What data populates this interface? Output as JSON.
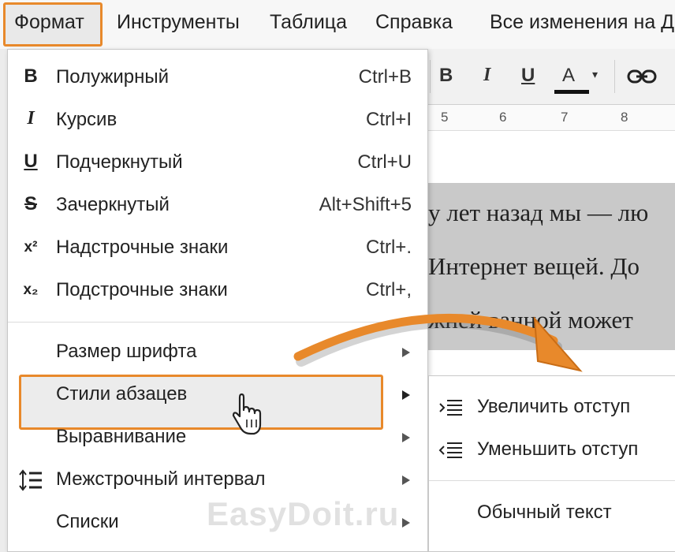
{
  "menubar": {
    "items": [
      {
        "label": "Формат"
      },
      {
        "label": "Инструменты"
      },
      {
        "label": "Таблица"
      },
      {
        "label": "Справка"
      },
      {
        "label": "Все изменения на Д"
      }
    ]
  },
  "toolbar": {
    "bold": "B",
    "italic": "I",
    "underline": "U",
    "text_color": "A",
    "link_icon": "link-icon"
  },
  "ruler": {
    "ticks": [
      "5",
      "6",
      "7",
      "8"
    ]
  },
  "document": {
    "lines": [
      "у лет назад мы — лю",
      "Интернет вещей. До",
      "жней ванной может"
    ]
  },
  "menu": {
    "items": [
      {
        "icon": "B",
        "label": "Полужирный",
        "shortcut": "Ctrl+B"
      },
      {
        "icon": "I",
        "label": "Курсив",
        "shortcut": "Ctrl+I"
      },
      {
        "icon": "U",
        "label": "Подчеркнутый",
        "shortcut": "Ctrl+U"
      },
      {
        "icon": "S",
        "label": "Зачеркнутый",
        "shortcut": "Alt+Shift+5"
      },
      {
        "icon": "x²",
        "label": "Надстрочные знаки",
        "shortcut": "Ctrl+."
      },
      {
        "icon": "x₂",
        "label": "Подстрочные знаки",
        "shortcut": "Ctrl+,"
      },
      {
        "label": "Размер шрифта"
      },
      {
        "label": "Стили абзацев"
      },
      {
        "label": "Выравнивание"
      },
      {
        "label": "Межстрочный интервал"
      },
      {
        "label": "Списки"
      }
    ]
  },
  "submenu": {
    "items": [
      {
        "label": "Увеличить отступ"
      },
      {
        "label": "Уменьшить отступ"
      },
      {
        "label": "Обычный текст"
      }
    ]
  },
  "watermark": "EasyDoit.ru",
  "colors": {
    "highlight_border": "#e8892b",
    "arrow": "#e8892b"
  }
}
